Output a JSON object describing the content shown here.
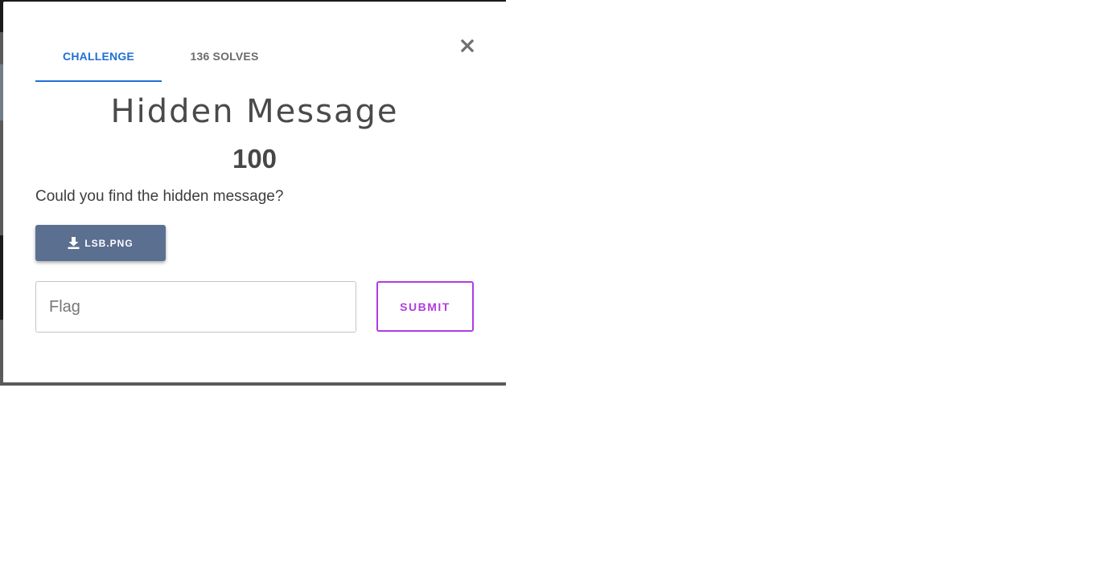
{
  "tabs": [
    {
      "label": "CHALLENGE",
      "active": true
    },
    {
      "label": "136 SOLVES",
      "active": false
    }
  ],
  "challenge": {
    "title": "Hidden Message",
    "points": "100",
    "description": "Could you find the hidden message?"
  },
  "download": {
    "label": "LSB.PNG",
    "icon": "download-icon"
  },
  "flag_input": {
    "placeholder": "Flag",
    "value": ""
  },
  "submit": {
    "label": "SUBMIT"
  },
  "close": {
    "icon": "close-icon"
  },
  "colors": {
    "accent": "#1f6fd6",
    "download_button": "#5b6f90",
    "submit": "#b03ce0"
  }
}
